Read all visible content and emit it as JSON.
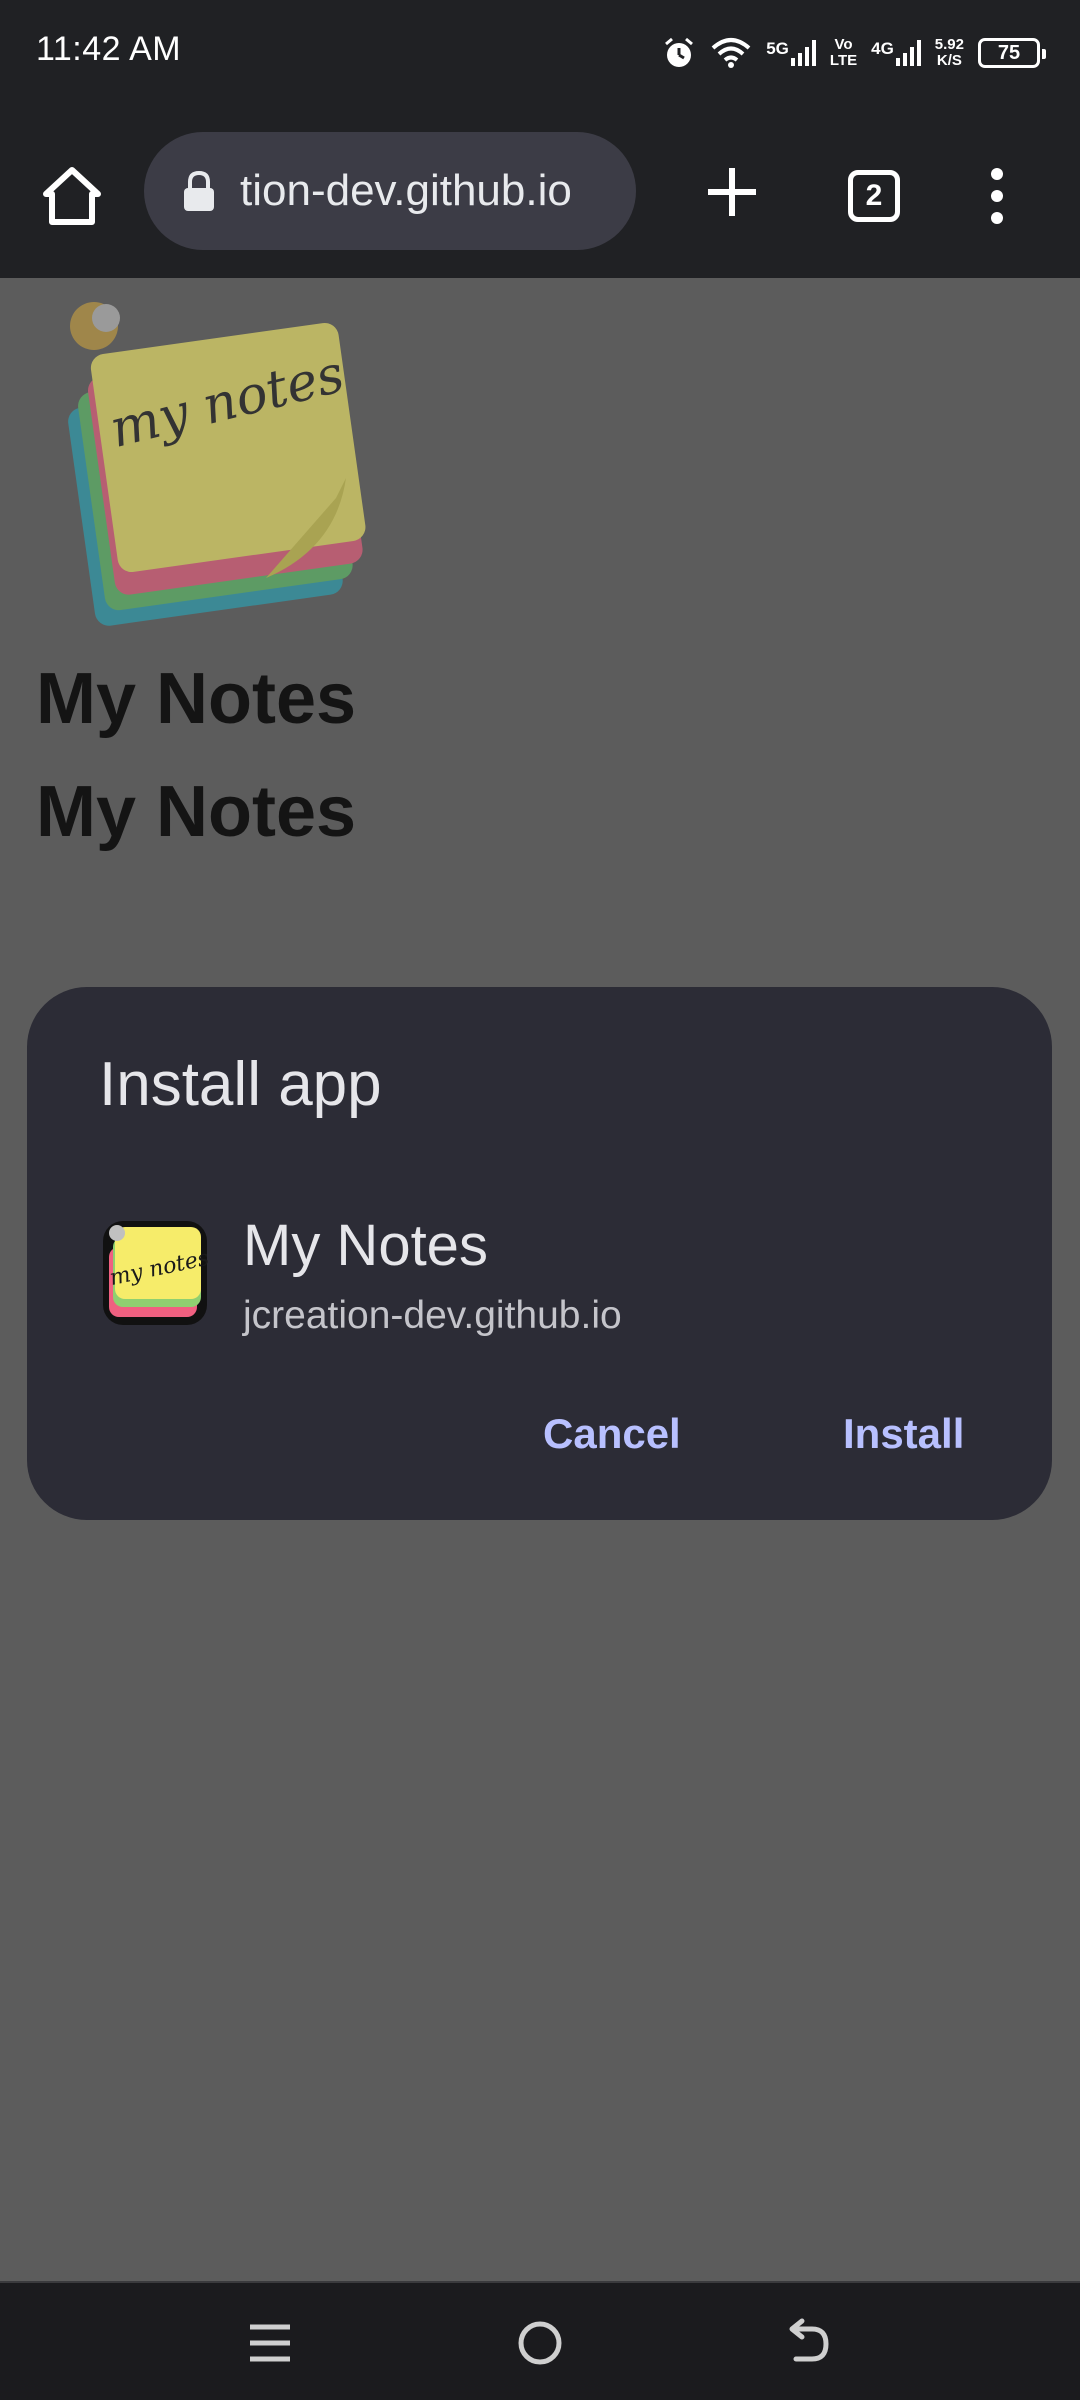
{
  "status_bar": {
    "time": "11:42 AM",
    "network_5g": "5G",
    "volte_top": "Vo",
    "volte_bottom": "LTE",
    "network_4g": "4G",
    "speed_value": "5.92",
    "speed_unit": "K/S",
    "battery": "75"
  },
  "toolbar": {
    "url": "tion-dev.github.io",
    "tab_count": "2"
  },
  "page": {
    "heading_1": "My Notes",
    "heading_2": "My Notes",
    "logo_text": "my notes"
  },
  "dialog": {
    "title": "Install app",
    "app_name": "My Notes",
    "app_url": "jcreation-dev.github.io",
    "cancel_label": "Cancel",
    "install_label": "Install"
  },
  "colors": {
    "accent": "#b8c0ff",
    "dialog_bg": "#2c2c36",
    "scrim": "#5c5c5c"
  }
}
